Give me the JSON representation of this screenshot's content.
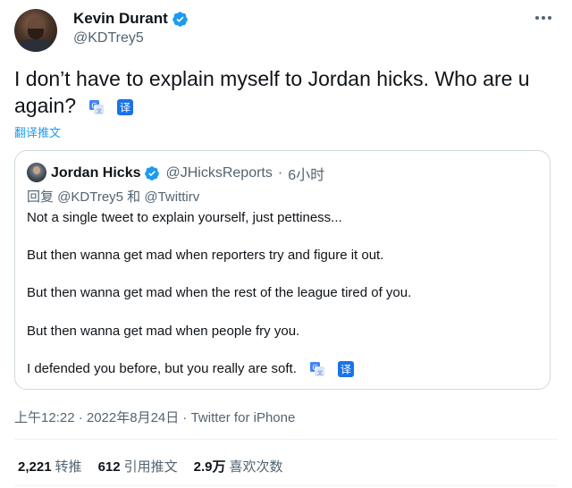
{
  "author": {
    "name": "Kevin Durant",
    "handle": "@KDTrey5"
  },
  "tweet": {
    "text": "I don’t have to explain myself to Jordan hicks. Who are u again?",
    "translate_link": "翻译推文"
  },
  "quoted": {
    "name": "Jordan Hicks",
    "handle": "@JHicksReports",
    "separator": "·",
    "time": "6小时",
    "reply_to": "回复 @KDTrey5 和 @Twittirv",
    "lines": [
      "Not a single tweet to explain yourself, just pettiness...",
      "But then wanna get mad when reporters try and figure it out.",
      "But then wanna get mad when the rest of the league tired of you.",
      "But then wanna get mad when people fry you.",
      "I defended you before, but you really are soft."
    ]
  },
  "meta": {
    "timestamp": "上午12:22 · 2022年8月24日 · Twitter for iPhone"
  },
  "stats": {
    "retweets_count": "2,221",
    "retweets_label": "转推",
    "quotes_count": "612",
    "quotes_label": "引用推文",
    "likes_count": "2.9万",
    "likes_label": "喜欢次数"
  },
  "colors": {
    "verified": "#1d9bf0",
    "link": "#1d9bf0",
    "secondary_text": "#536471",
    "border": "#cfd9de"
  },
  "icons": [
    "verified-badge-icon",
    "more-options-icon",
    "google-translate-icon",
    "chinese-translate-icon"
  ]
}
